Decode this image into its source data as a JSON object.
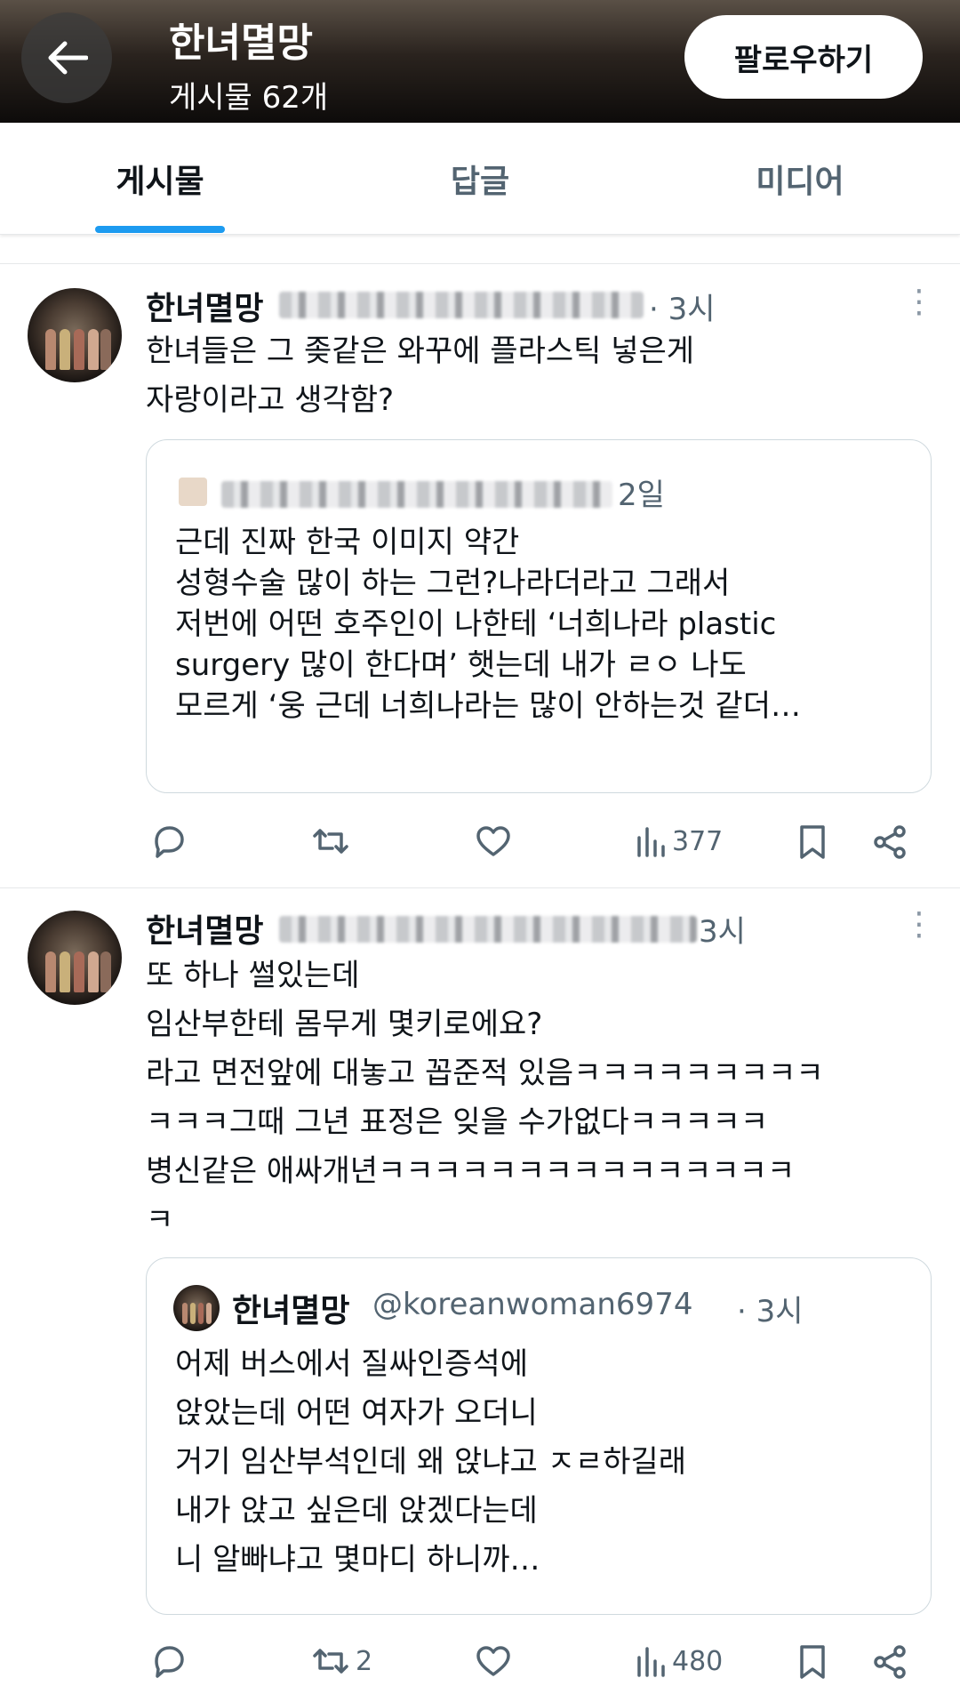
{
  "header": {
    "title": "한녀멸망",
    "post_count": "게시물 62개",
    "follow_label": "팔로우하기"
  },
  "tabs": [
    {
      "label": "게시물"
    },
    {
      "label": "답글"
    },
    {
      "label": "미디어"
    }
  ],
  "posts": [
    {
      "author": "한녀멸망",
      "time": "· 3시",
      "text": "한녀들은 그 좆같은 와꾸에 플라스틱 넣은게\n자랑이라고 생각함?",
      "quote": {
        "time": "2일",
        "text": "근데 진짜 한국 이미지 약간\n성형수술 많이 하는 그런?나라더라고 그래서\n저번에 어떤 호주인이 나한테 ‘너희나라 plastic\nsurgery 많이 한다며’ 햇는데 내가 ㄹㅇ 나도\n모르게 ‘웅 근데 너희나라는 많이 안하는것 같더…"
      },
      "views": "377",
      "retweets": ""
    },
    {
      "author": "한녀멸망",
      "time": "3시",
      "text": "또 하나 썰있는데\n임산부한테 몸무게 몇키로에요?\n라고 면전앞에 대놓고 꼽준적 있음ㅋㅋㅋㅋㅋㅋㅋㅋㅋ\nㅋㅋㅋ그때 그년 표정은 잊을 수가없다ㅋㅋㅋㅋㅋ\n병신같은 애싸개년ㅋㅋㅋㅋㅋㅋㅋㅋㅋㅋㅋㅋㅋㅋㅋ\nㅋ",
      "quote": {
        "author": "한녀멸망",
        "handle": "@koreanwoman6974",
        "time": "· 3시",
        "text": "어제 버스에서 질싸인증석에\n앉았는데 어떤 여자가 오더니\n거기 임산부석인데 왜 앉냐고 ㅈㄹ하길래\n내가 앉고 싶은데 앉겠다는데\n니 알빠냐고 몇마디 하니까…"
      },
      "views": "480",
      "retweets": "2"
    }
  ],
  "colors": {
    "accent": "#1d9bf0",
    "text": "#0f1419",
    "muted": "#536471"
  },
  "icons": [
    "back-arrow-icon",
    "more-icon",
    "reply-icon",
    "retweet-icon",
    "like-icon",
    "views-icon",
    "bookmark-icon",
    "share-icon"
  ]
}
